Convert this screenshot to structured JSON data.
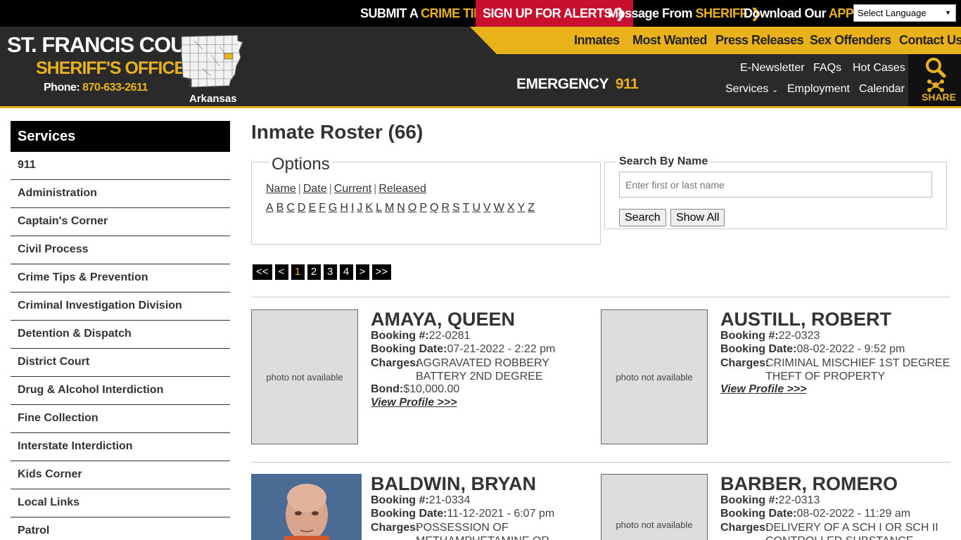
{
  "topbar": {
    "submit_tip": {
      "pre": "SUBMIT A ",
      "accent": "CRIME TIP"
    },
    "alerts": "SIGN UP FOR ALERTS",
    "message": {
      "pre": "Message From ",
      "accent": "SHERIFF"
    },
    "download": {
      "pre": "Download Our ",
      "accent": "APP"
    },
    "language": "Select Language"
  },
  "logo": {
    "title": "ST. FRANCIS COUNTY",
    "subtitle": "SHERIFF'S OFFICE",
    "phone_label": "Phone: ",
    "phone": "870-633-2611",
    "state": "Arkansas"
  },
  "main_nav": [
    "Inmates",
    "Most Wanted",
    "Press Releases",
    "Sex Offenders",
    "Contact Us"
  ],
  "emergency": {
    "label": "EMERGENCY",
    "number": "911"
  },
  "sub_nav": {
    "enewsletter": "E-Newsletter",
    "faqs": "FAQs",
    "hot_cases": "Hot Cases",
    "services": "Services",
    "employment": "Employment",
    "calendar": "Calendar"
  },
  "share": "SHARE",
  "sidebar": {
    "title": "Services",
    "items": [
      "911",
      "Administration",
      "Captain's Corner",
      "Civil Process",
      "Crime Tips & Prevention",
      "Criminal Investigation Division",
      "Detention & Dispatch",
      "District Court",
      "Drug & Alcohol Interdiction",
      "Fine Collection",
      "Interstate Interdiction",
      "Kids Corner",
      "Local Links",
      "Patrol"
    ]
  },
  "page": {
    "title": "Inmate Roster (66)"
  },
  "options": {
    "legend": "Options",
    "sort": [
      "Name",
      "Date",
      "Current",
      "Released"
    ],
    "letters": [
      "A",
      "B",
      "C",
      "D",
      "E",
      "F",
      "G",
      "H",
      "I",
      "J",
      "K",
      "L",
      "M",
      "N",
      "O",
      "P",
      "Q",
      "R",
      "S",
      "T",
      "U",
      "V",
      "W",
      "X",
      "Y",
      "Z"
    ]
  },
  "search": {
    "legend": "Search By Name",
    "placeholder": "Enter first or last name",
    "search_btn": "Search",
    "show_all_btn": "Show All"
  },
  "pager": [
    "<<",
    "<",
    "1",
    "2",
    "3",
    "4",
    ">",
    ">>"
  ],
  "labels": {
    "booking_no": "Booking #:",
    "booking_date": "Booking Date:",
    "charges": "Charges:",
    "bond": "Bond:",
    "view_profile": "View Profile >>>",
    "photo_na": "photo not available"
  },
  "inmates": [
    {
      "name": "AMAYA, QUEEN",
      "booking_no": "22-0281",
      "booking_date": "07-21-2022 - 2:22 pm",
      "charges": [
        "AGGRAVATED ROBBERY",
        "BATTERY 2ND DEGREE"
      ],
      "bond": "$10,000.00"
    },
    {
      "name": "AUSTILL, ROBERT",
      "booking_no": "22-0323",
      "booking_date": "08-02-2022 - 9:52 pm",
      "charges": [
        "CRIMINAL MISCHIEF 1ST DEGREE",
        "THEFT OF PROPERTY"
      ]
    },
    {
      "name": "BALDWIN, BRYAN",
      "booking_no": "21-0334",
      "booking_date": "11-12-2021 - 6:07 pm",
      "charges": [
        "POSSESSION OF",
        "METHAMPHETAMINE OR"
      ]
    },
    {
      "name": "BARBER, ROMERO",
      "booking_no": "22-0313",
      "booking_date": "08-02-2022 - 11:29 am",
      "charges": [
        "DELIVERY OF A SCH I OR SCH II",
        "CONTROLLED SUBSTANCE"
      ]
    }
  ],
  "colors": {
    "accent": "#e9b21b",
    "alert": "#c8102e",
    "header": "#2a2a2a"
  }
}
